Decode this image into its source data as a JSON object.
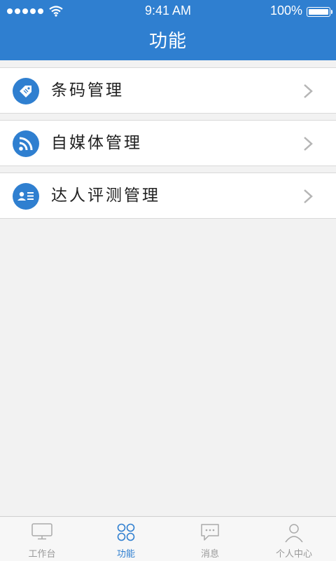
{
  "status_bar": {
    "time": "9:41 AM",
    "battery": "100%"
  },
  "header": {
    "title": "功能"
  },
  "menu": {
    "items": [
      {
        "label": "条码管理",
        "icon": "barcode-tag-icon"
      },
      {
        "label": "自媒体管理",
        "icon": "rss-icon"
      },
      {
        "label": "达人评测管理",
        "icon": "profile-card-icon"
      }
    ]
  },
  "tabbar": {
    "tabs": [
      {
        "label": "工作台",
        "icon": "monitor-icon",
        "active": false
      },
      {
        "label": "功能",
        "icon": "grid-circles-icon",
        "active": true
      },
      {
        "label": "消息",
        "icon": "chat-bubble-icon",
        "active": false
      },
      {
        "label": "个人中心",
        "icon": "person-icon",
        "active": false
      }
    ]
  },
  "colors": {
    "primary": "#2f7fd0",
    "background": "#f2f2f2",
    "inactive": "#999999"
  }
}
